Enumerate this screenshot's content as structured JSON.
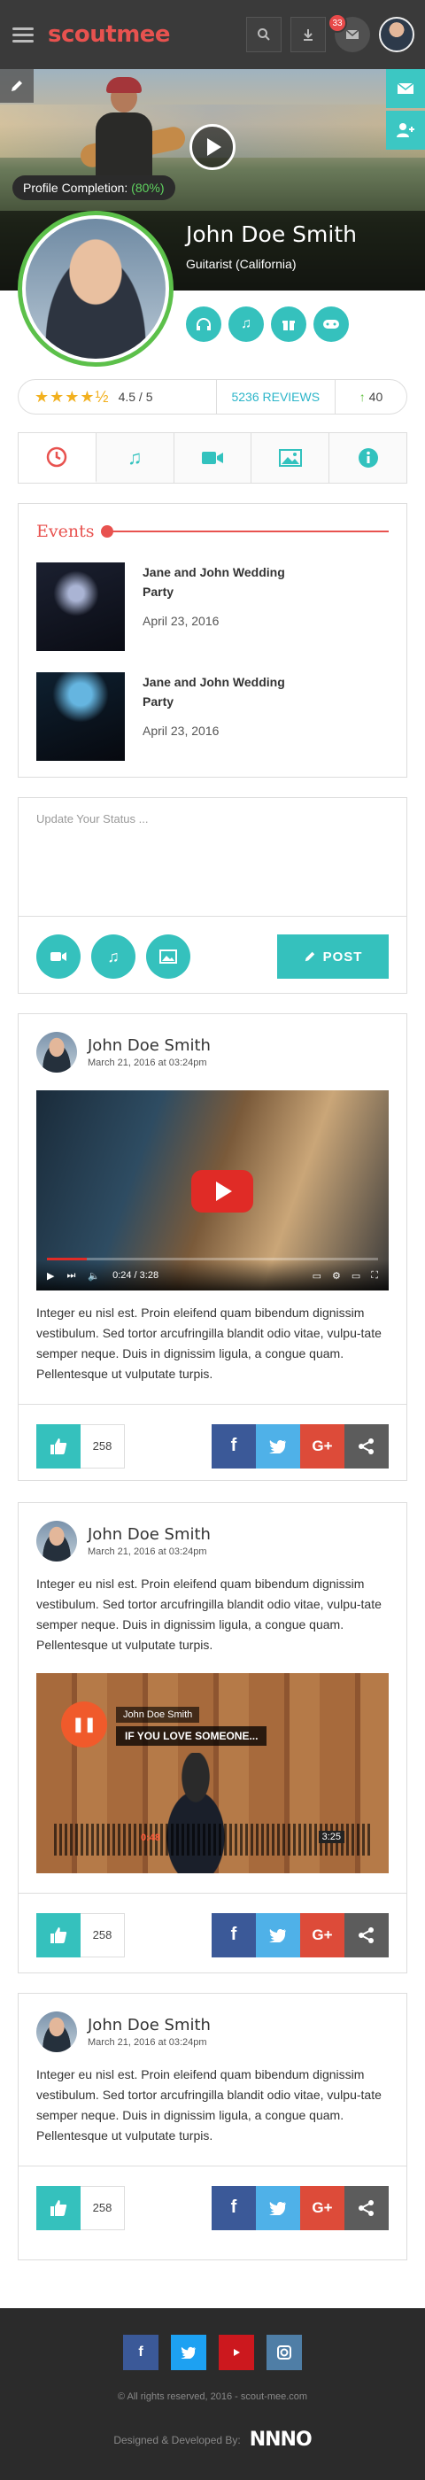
{
  "app": {
    "logo": "scoutmee",
    "notification_count": "33"
  },
  "profile": {
    "completion_label": "Profile Completion: ",
    "completion_value": "(80%)",
    "name": "John Doe Smith",
    "role": "Guitarist (California)"
  },
  "rating": {
    "stars": "★★★★½",
    "score": "4.5 / 5",
    "reviews": "5236 REVIEWS",
    "up_arrow": "↑",
    "up_count": "40"
  },
  "events": {
    "title": "Events",
    "items": [
      {
        "title": "Jane and John Wedding Party",
        "date": "April 23, 2016"
      },
      {
        "title": "Jane and John Wedding Party",
        "date": "April 23, 2016"
      }
    ]
  },
  "status": {
    "placeholder": "Update Your Status ...",
    "post_label": "POST"
  },
  "posts": [
    {
      "author": "John Doe Smith",
      "time": "March 21, 2016 at 03:24pm",
      "text": "Integer eu nisl est. Proin eleifend quam bibendum dignissim vestibulum. Sed tortor arcufringilla blandit odio vitae, vulpu-tate semper neque. Duis in dignissim ligula, a congue quam. Pellentesque ut vulputate turpis.",
      "video_time": "0:24 / 3:28",
      "likes": "258"
    },
    {
      "author": "John Doe Smith",
      "time": "March 21, 2016 at 03:24pm",
      "text": "Integer eu nisl est. Proin eleifend quam bibendum dignissim vestibulum. Sed tortor arcufringilla blandit odio vitae, vulpu-tate semper neque. Duis in dignissim ligula, a congue quam. Pellentesque ut vulputate turpis.",
      "audio_artist": "John Doe Smith",
      "audio_title": "IF YOU LOVE SOMEONE...",
      "audio_elapsed": "0:48",
      "audio_total": "3:25",
      "likes": "258"
    },
    {
      "author": "John Doe Smith",
      "time": "March 21, 2016 at 03:24pm",
      "text": "Integer eu nisl est. Proin eleifend quam bibendum dignissim vestibulum. Sed tortor arcufringilla blandit odio vitae, vulpu-tate semper neque. Duis in dignissim ligula, a congue quam. Pellentesque ut vulputate turpis.",
      "likes": "258"
    }
  ],
  "share": {
    "facebook": "f",
    "twitter": "t",
    "google": "G+"
  },
  "footer": {
    "copyright": "© All rights reserved, 2016 - scout-mee.com",
    "designed_by": "Designed & Developed By:",
    "dev_logo": "NNNO"
  },
  "colors": {
    "brand": "#e8524f",
    "accent": "#35c1bd",
    "dark": "#3a3a3a"
  }
}
